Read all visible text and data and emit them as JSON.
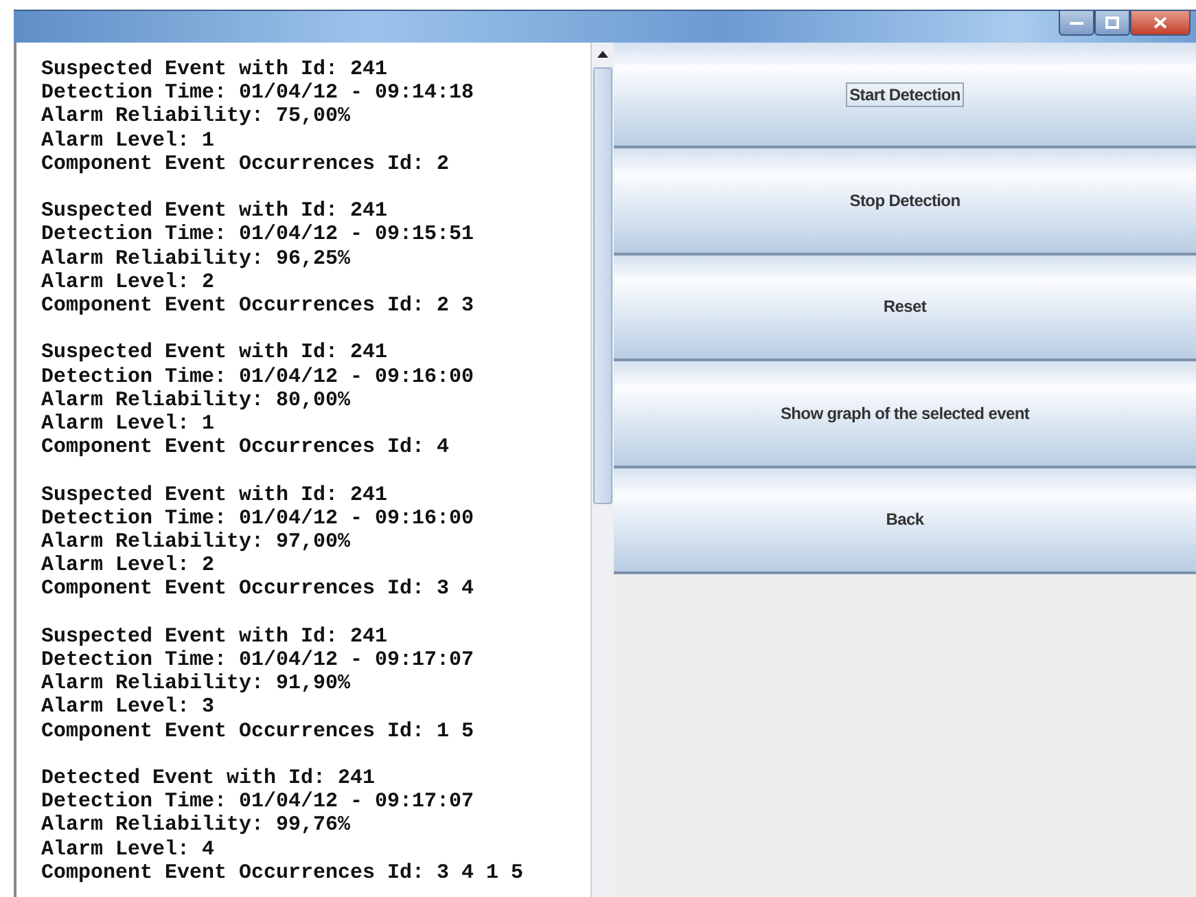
{
  "events": [
    {
      "lines": [
        "Suspected Event with Id: 241",
        "Detection Time: 01/04/12 - 09:14:18",
        "Alarm Reliability: 75,00%",
        "Alarm Level: 1",
        "Component Event Occurrences Id: 2"
      ]
    },
    {
      "lines": [
        "Suspected Event with Id: 241",
        "Detection Time: 01/04/12 - 09:15:51",
        "Alarm Reliability: 96,25%",
        "Alarm Level: 2",
        "Component Event Occurrences Id: 2 3"
      ]
    },
    {
      "lines": [
        "Suspected Event with Id: 241",
        "Detection Time: 01/04/12 - 09:16:00",
        "Alarm Reliability: 80,00%",
        "Alarm Level: 1",
        "Component Event Occurrences Id: 4"
      ]
    },
    {
      "lines": [
        "Suspected Event with Id: 241",
        "Detection Time: 01/04/12 - 09:16:00",
        "Alarm Reliability: 97,00%",
        "Alarm Level: 2",
        "Component Event Occurrences Id: 3 4"
      ]
    },
    {
      "lines": [
        "Suspected Event with Id: 241",
        "Detection Time: 01/04/12 - 09:17:07",
        "Alarm Reliability: 91,90%",
        "Alarm Level: 3",
        "Component Event Occurrences Id: 1 5"
      ]
    },
    {
      "lines": [
        "Detected Event with Id: 241",
        "Detection Time: 01/04/12 - 09:17:07",
        "Alarm Reliability: 99,76%",
        "Alarm Level: 4",
        "Component Event Occurrences Id: 3 4 1 5"
      ]
    }
  ],
  "buttons": [
    {
      "label": "Start Detection",
      "focused": true
    },
    {
      "label": "Stop Detection",
      "focused": false
    },
    {
      "label": "Reset",
      "focused": false
    },
    {
      "label": "Show graph of the selected event",
      "focused": false
    },
    {
      "label": "Back",
      "focused": false
    }
  ]
}
